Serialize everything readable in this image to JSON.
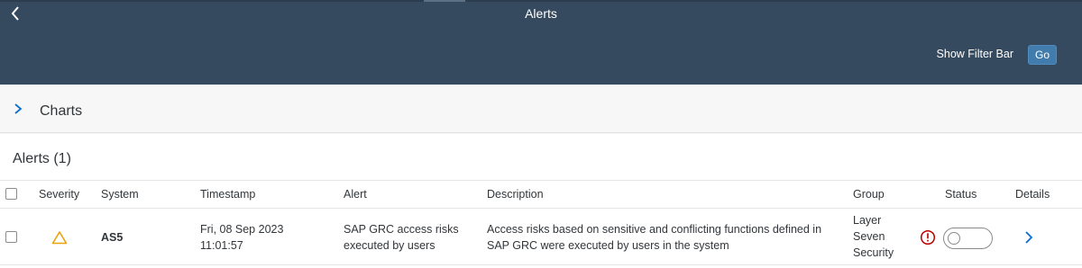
{
  "shell": {
    "title": "Alerts",
    "back_icon": "chevron-left-icon"
  },
  "header": {
    "show_filter_bar_label": "Show Filter Bar",
    "go_label": "Go",
    "accent": "#427cac"
  },
  "charts_panel": {
    "label": "Charts",
    "icon": "chevron-right-icon"
  },
  "table": {
    "title": "Alerts (1)",
    "columns": [
      "Severity",
      "System",
      "Timestamp",
      "Alert",
      "Description",
      "Group",
      "Status",
      "Details"
    ],
    "rows": [
      {
        "severity_icon": "warning-triangle-icon",
        "severity_color": "#e9730c",
        "system": "AS5",
        "timestamp_line1": "Fri, 08 Sep 2023",
        "timestamp_line2": "11:01:57",
        "alert_line1": "SAP GRC access risks",
        "alert_line2": "executed by users",
        "description_line1": "Access risks based on sensitive and conflicting functions defined in",
        "description_line2": "SAP GRC were executed by users in the system",
        "group_line1": "Layer",
        "group_line2": "Seven",
        "group_line3": "Security",
        "status_icon": "error-circle-icon",
        "status_color": "#bb0000",
        "toggle_state": "off",
        "details_icon": "chevron-right-icon"
      }
    ]
  }
}
